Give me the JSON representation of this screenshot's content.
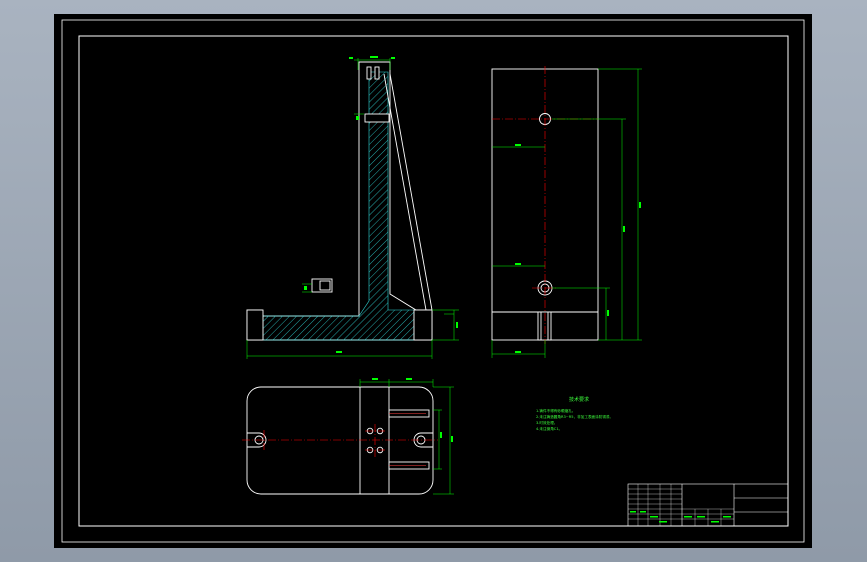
{
  "colors": {
    "viewport_bg": "#9ba6b4",
    "paper": "#000000",
    "frame": "#ffffff",
    "outline": "#ffffff",
    "dimension": "#00ff00",
    "centerline": "#ff0000",
    "hatch": "#2fd6d6",
    "title_block_green": "#00ff00"
  },
  "views": {
    "front_view": "section-view",
    "side_view": "side-view",
    "top_view": "plan-view"
  },
  "tech_requirements": {
    "heading": "技术要求",
    "lines": [
      "1.铸件不得有砂眼缩孔。",
      "2.未注铸造圆角R3~R5，非加工表面涂防锈漆。",
      "3.时效处理。",
      "4.未注倒角C1。"
    ]
  }
}
